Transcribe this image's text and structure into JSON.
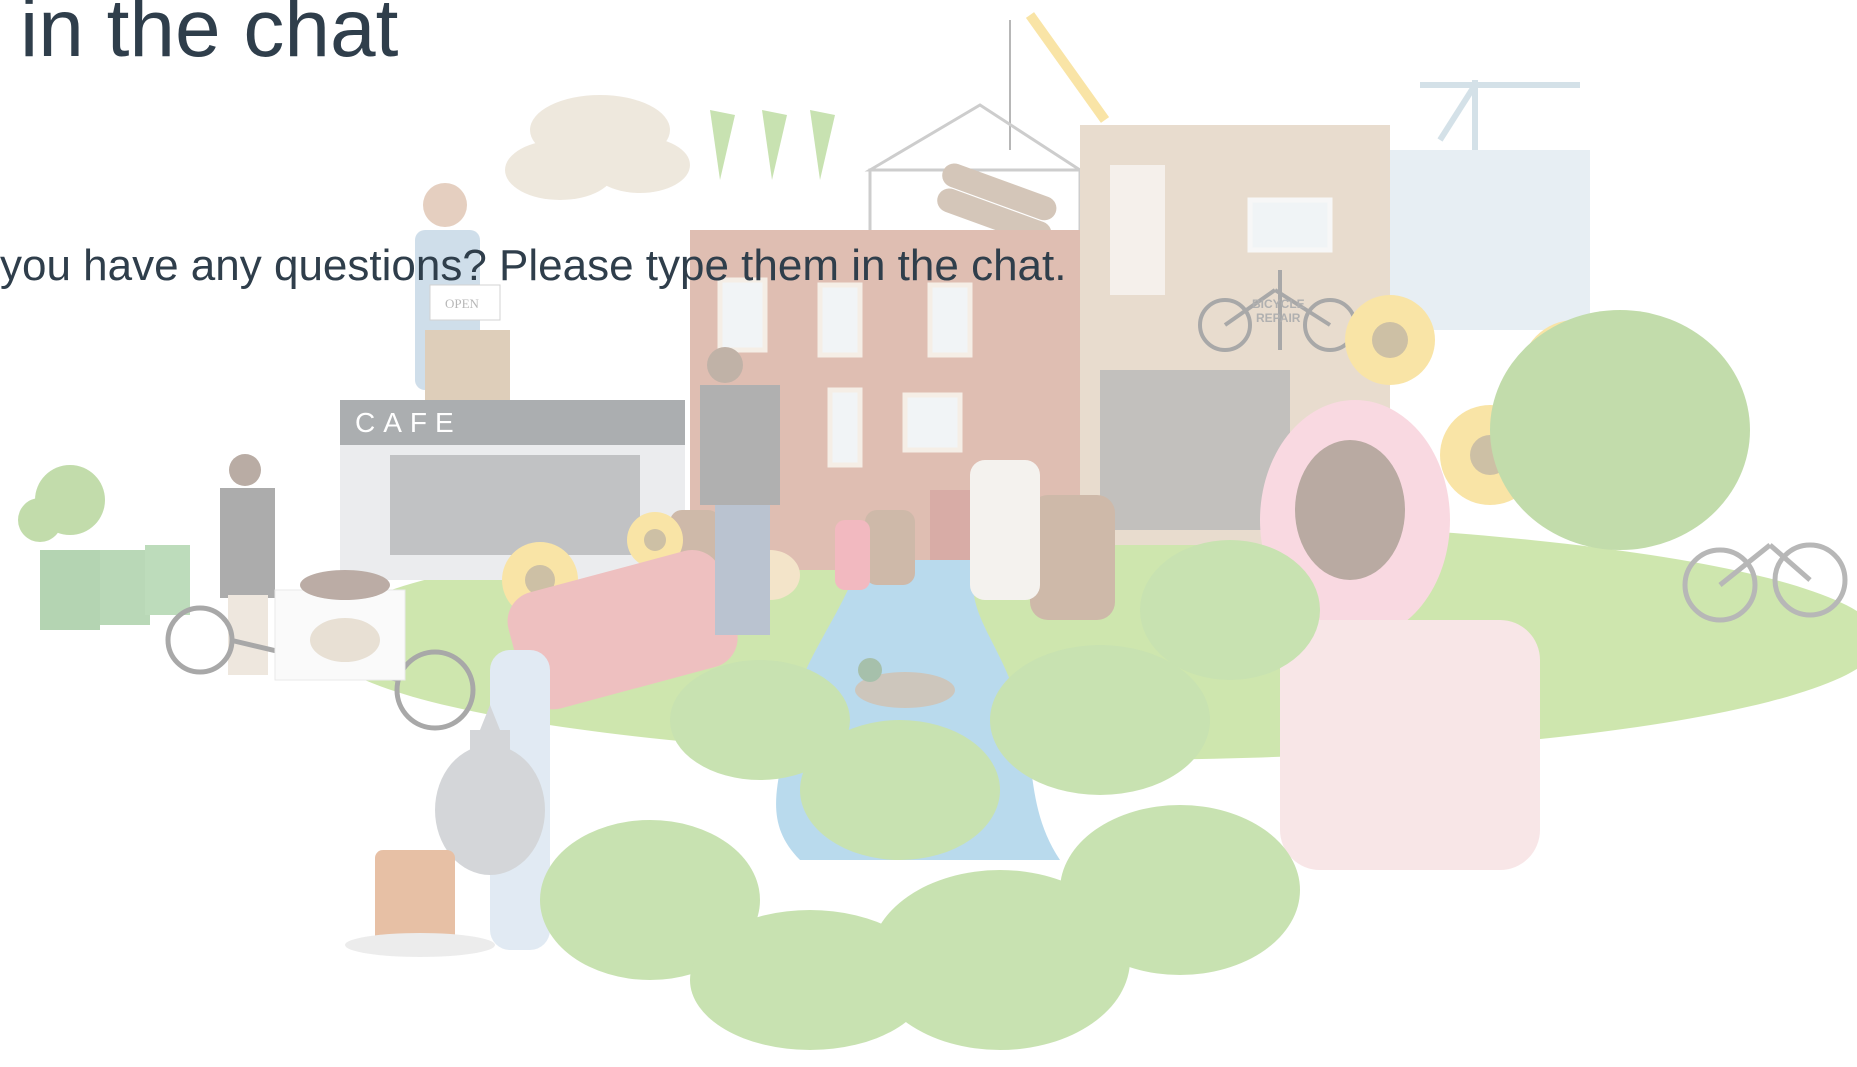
{
  "slide": {
    "title": "in the chat",
    "subtitle": "you have any questions? Please type them in the chat."
  },
  "illustration": {
    "cafe_sign": "CAFE",
    "open_sign": "OPEN",
    "bicycle_sign_line1": "BICYCLE",
    "bicycle_sign_line2": "REPAIR"
  },
  "colors": {
    "text": "#2f3e4b",
    "background": "#ffffff",
    "water": "#5aa9d6",
    "foliage": "#6fae3a",
    "sunflower": "#f2c12e",
    "brick": "#b5654a",
    "hijab": "#f3a7b9"
  }
}
